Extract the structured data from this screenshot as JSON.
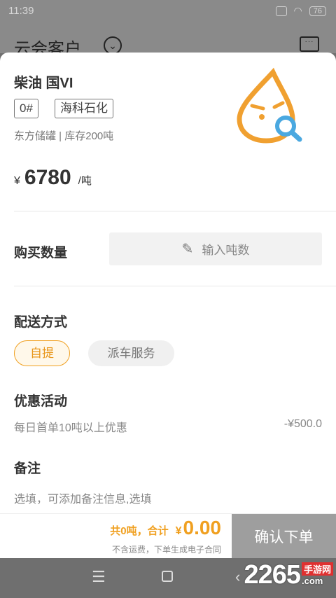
{
  "status_bar": {
    "time": "11:39",
    "battery": "76"
  },
  "header": {
    "title": "云会客户"
  },
  "product": {
    "name": "柴油 国VI",
    "grade": "0#",
    "supplier": "海科石化",
    "storage": "东方储罐 | 库存200吨",
    "currency_symbol": "¥",
    "price": "6780",
    "unit": "/吨"
  },
  "quantity": {
    "label": "购买数量",
    "placeholder": "输入吨数"
  },
  "delivery": {
    "label": "配送方式",
    "options": [
      "自提",
      "派车服务"
    ],
    "selected": "自提"
  },
  "promotion": {
    "label": "优惠活动",
    "text": "每日首单10吨以上优惠",
    "amount": "-¥500.0"
  },
  "remark": {
    "label": "备注",
    "placeholder": "选填，可添加备注信息,选填"
  },
  "footer": {
    "total_prefix": "共0吨，合计",
    "currency_symbol": "¥",
    "total": "0.00",
    "note": "不含运费，下单生成电子合同",
    "confirm_label": "确认下单"
  },
  "watermark": {
    "number": "2265",
    "site_cn": "手游网",
    "site_com": ".com"
  },
  "colors": {
    "accent": "#f0a020",
    "logo_orange": "#f0a030",
    "logo_blue": "#4aa8e0",
    "button_gray": "#9e9e9e"
  }
}
